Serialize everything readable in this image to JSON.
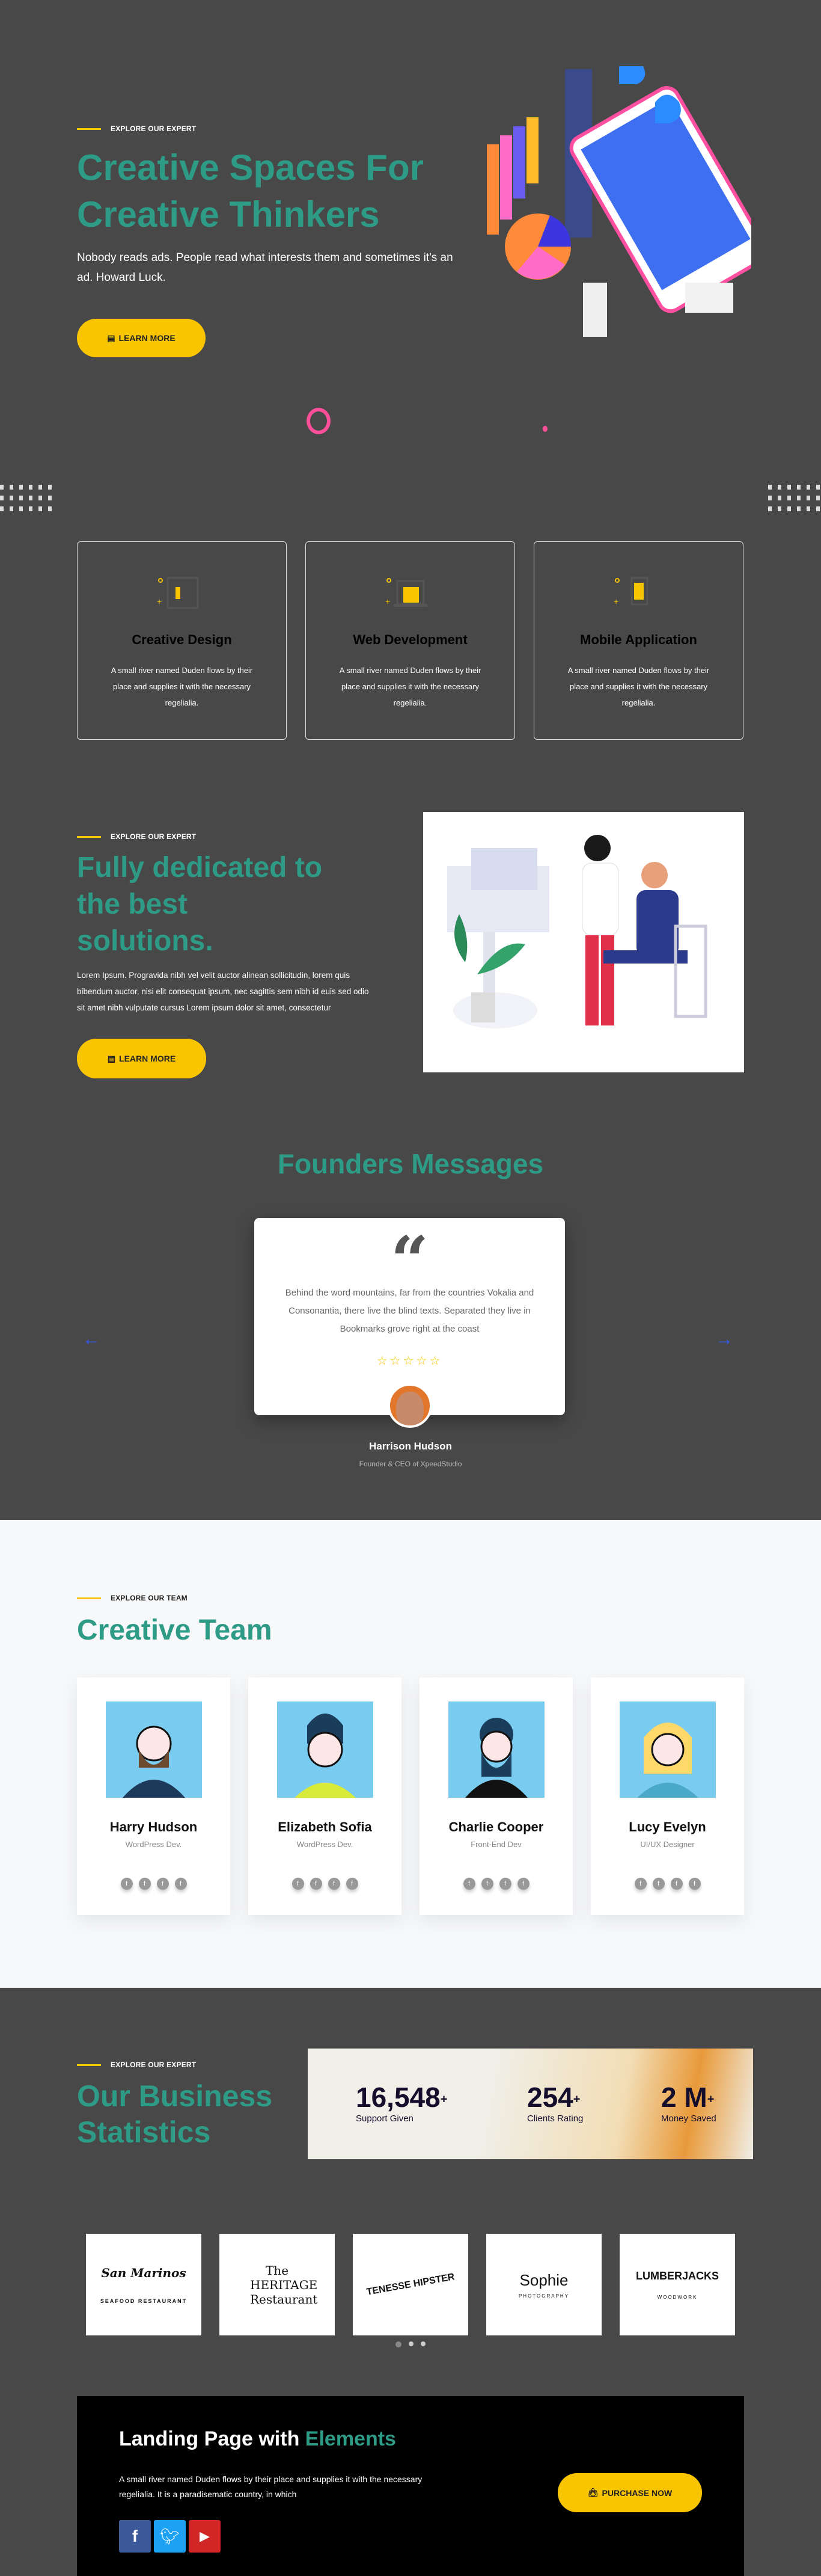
{
  "hero": {
    "eyebrow": "Explore Our Expert",
    "title_line1": "Creative Spaces For",
    "title_line2": "Creative Thinkers",
    "text": "Nobody reads ads. People read what interests them and sometimes it's an ad. Howard Luck.",
    "button": "LEARN MORE"
  },
  "services": [
    {
      "title": "Creative Design",
      "text": "A small river named Duden flows by their place and supplies it with the necessary regelialia."
    },
    {
      "title": "Web Development",
      "text": "A small river named Duden flows by their place and supplies it with the necessary regelialia."
    },
    {
      "title": "Mobile Application",
      "text": "A small river named Duden flows by their place and supplies it with the necessary regelialia."
    }
  ],
  "dedicated": {
    "eyebrow": "Explore Our Expert",
    "title": "Fully dedicated to the best solutions.",
    "text": "Lorem Ipsum. Progravida nibh vel velit auctor alinean sollicitudin, lorem quis bibendum auctor, nisi elit consequat ipsum, nec sagittis sem nibh id euis sed odio sit amet nibh vulputate cursus Lorem ipsum dolor sit amet, consectetur",
    "button": "LEARN MORE"
  },
  "founders": {
    "title": "Founders Messages",
    "quote": "Behind the word mountains, far from the countries Vokalia and Consonantia, there live the blind texts. Separated they live in Bookmarks grove right at the coast",
    "rating": 5,
    "name": "Harrison Hudson",
    "role": "Founder & CEO of XpeedStudio"
  },
  "team": {
    "eyebrow": "Explore Our Team",
    "title": "Creative Team",
    "members": [
      {
        "name": "Harry Hudson",
        "role": "WordPress Dev."
      },
      {
        "name": "Elizabeth Sofia",
        "role": "WordPress Dev."
      },
      {
        "name": "Charlie Cooper",
        "role": "Front-End Dev"
      },
      {
        "name": "Lucy Evelyn",
        "role": "UI/UX Designer"
      }
    ]
  },
  "stats": {
    "eyebrow": "Explore Our Expert",
    "title_line1": "Our Business",
    "title_line2": "Statistics",
    "items": [
      {
        "value": "16,548",
        "suffix": "+",
        "label": "Support Given"
      },
      {
        "value": "254",
        "suffix": "+",
        "label": "Clients Rating"
      },
      {
        "value": "2 M",
        "suffix": "+",
        "label": "Money Saved"
      }
    ]
  },
  "logos": [
    "San Marinos",
    "The HERITAGE Restaurant",
    "TENESSE HIPSTER",
    "Sophie",
    "LUMBERJACKS"
  ],
  "logo_sub": [
    "SEAFOOD RESTAURANT",
    "",
    "",
    "PHOTOGRAPHY",
    "WOODWORK"
  ],
  "carousel": {
    "pages": 3,
    "active": 0
  },
  "cta": {
    "title": "Landing Page with ",
    "title_accent": "Elements",
    "text": "A small river named Duden flows by their place and supplies it with the necessary regelialia. It is a paradisematic country, in which",
    "button": "PURCHASE NOW"
  },
  "colors": {
    "accent": "#2e9b86",
    "yellow": "#f9c400",
    "bg": "#484848"
  }
}
